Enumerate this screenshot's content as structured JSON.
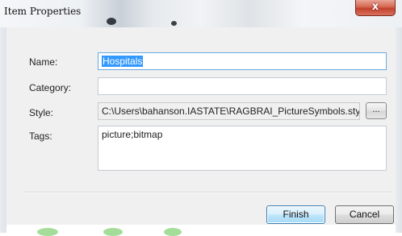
{
  "window": {
    "title": "Item Properties",
    "close_glyph": "x"
  },
  "fields": {
    "name": {
      "label": "Name:",
      "value": "Hospitals"
    },
    "category": {
      "label": "Category:",
      "value": ""
    },
    "style": {
      "label": "Style:",
      "value": "C:\\Users\\bahanson.IASTATE\\RAGBRAI_PictureSymbols.style",
      "browse_label": "..."
    },
    "tags": {
      "label": "Tags:",
      "value": "picture;bitmap"
    }
  },
  "buttons": {
    "finish": "Finish",
    "cancel": "Cancel"
  },
  "colors": {
    "selection": "#3399ff",
    "close_button": "#c2412b",
    "default_button_border": "#3c7fb1"
  }
}
